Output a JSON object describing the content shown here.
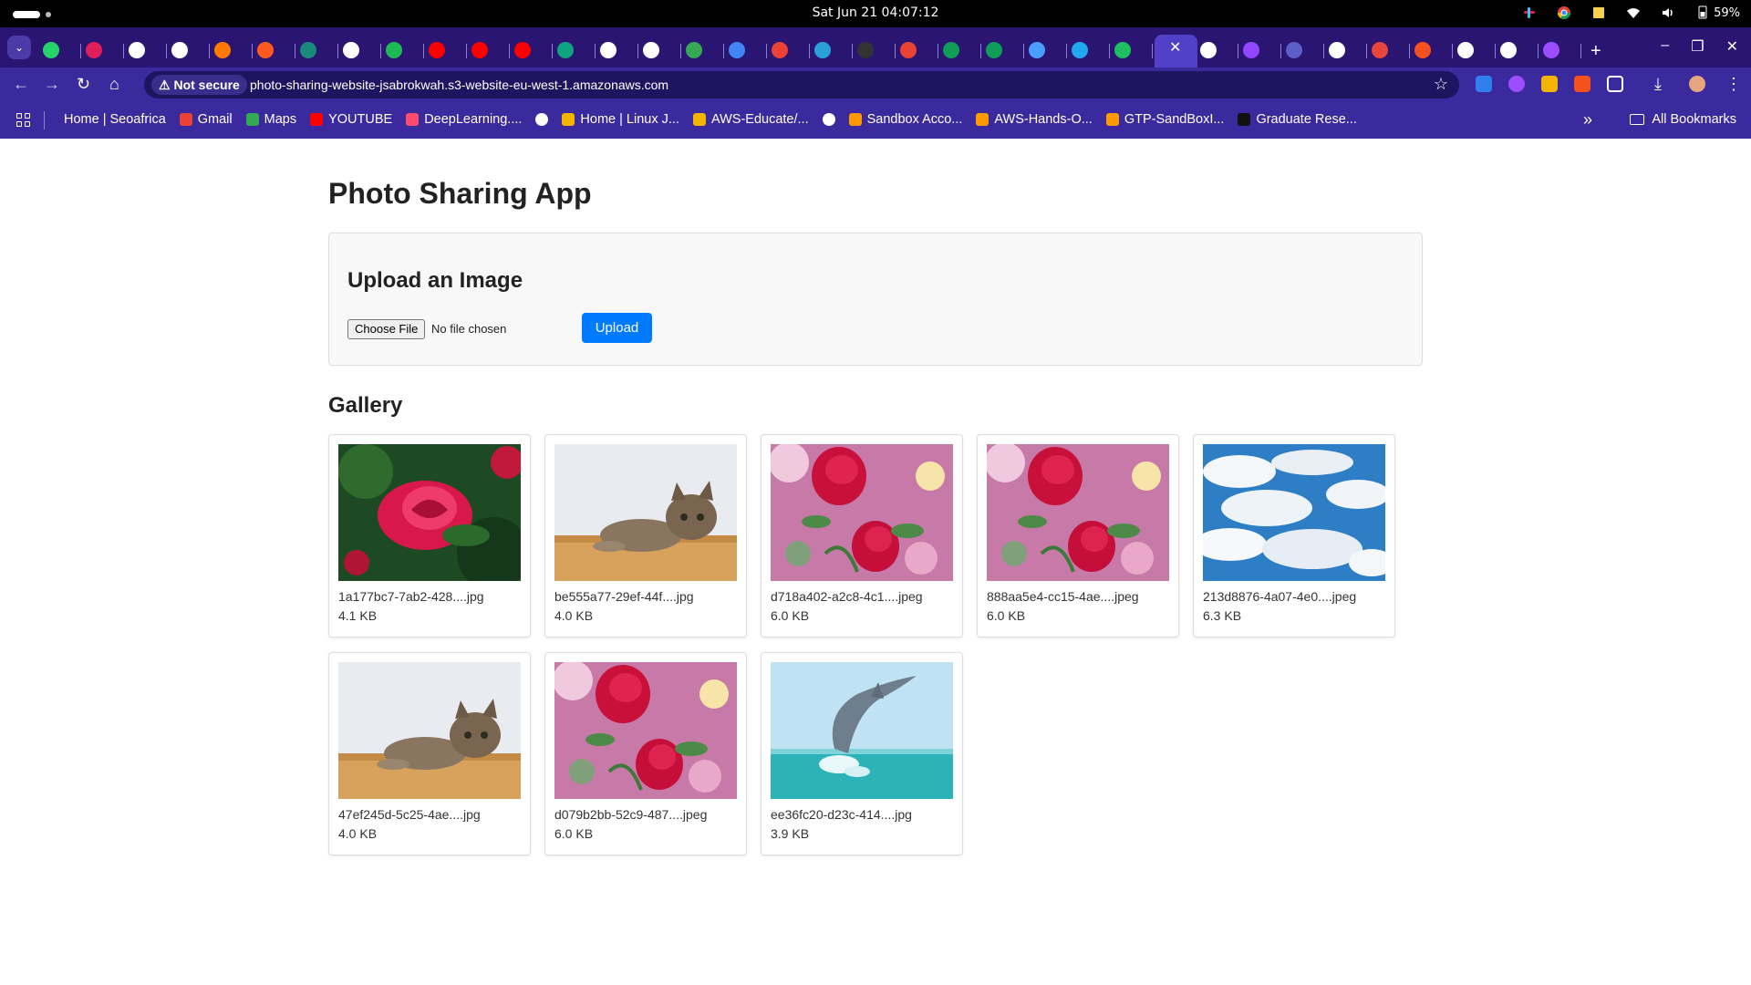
{
  "system": {
    "clock": "Sat Jun 21  04:07:12",
    "battery": "59%"
  },
  "browser": {
    "active_tab_close": "✕",
    "new_tab": "+",
    "tab_favicon_colors": [
      "#25d366",
      "#e01e5a",
      "#ffffff",
      "#ffffff",
      "#ff7a00",
      "#ff5a1f",
      "#1a8a7a",
      "#ffffff",
      "#1db954",
      "#ff0000",
      "#ff0000",
      "#ff0000",
      "#10a37f",
      "#ffffff",
      "#ffffff",
      "#34a853",
      "#4285f4",
      "#ea4335",
      "#2aa0d8",
      "#333333",
      "#ea4335",
      "#0f9d58",
      "#0f9d58",
      "#4a9eff",
      "#22a7f0",
      "#1fbf5f",
      "#ffffff",
      "#9146ff",
      "#5b5fc7",
      "#ffffff",
      "#e8453c",
      "#f4511e",
      "#ffffff",
      "#ffffff",
      "#9c4dff"
    ],
    "url": "photo-sharing-website-jsabrokwah.s3-website-eu-west-1.amazonaws.com",
    "security_label": "Not secure",
    "bookmarks": [
      {
        "label": "Home | Seoafrica",
        "color": "#3b2a9e"
      },
      {
        "label": "Gmail",
        "color": "#ea4335"
      },
      {
        "label": "Maps",
        "color": "#34a853"
      },
      {
        "label": "YOUTUBE",
        "color": "#ff0000"
      },
      {
        "label": "DeepLearning....",
        "color": "#ff4b6e"
      },
      {
        "label": "",
        "color": "#ffffff"
      },
      {
        "label": "Home | Linux J...",
        "color": "#f4b400"
      },
      {
        "label": "AWS-Educate/...",
        "color": "#f4b400"
      },
      {
        "label": "",
        "color": "#ffffff"
      },
      {
        "label": "Sandbox Acco...",
        "color": "#ff9900"
      },
      {
        "label": "AWS-Hands-O...",
        "color": "#ff9900"
      },
      {
        "label": "GTP-SandBoxI...",
        "color": "#ff9900"
      },
      {
        "label": "Graduate Rese...",
        "color": "#111111"
      }
    ],
    "bookmarks_more": "»",
    "all_bookmarks": "All Bookmarks"
  },
  "app": {
    "title": "Photo Sharing App",
    "upload": {
      "heading": "Upload an Image",
      "choose_file_label": "Choose File",
      "file_status": "No file chosen",
      "upload_button": "Upload"
    },
    "gallery_title": "Gallery",
    "accent_color": "#007bff",
    "images": [
      {
        "name": "1a177bc7-7ab2-428....jpg",
        "size": "4.1 KB",
        "subject": "red-rose-garden"
      },
      {
        "name": "be555a77-29ef-44f....jpg",
        "size": "4.0 KB",
        "subject": "tabby-cat"
      },
      {
        "name": "d718a402-a2c8-4c1....jpeg",
        "size": "6.0 KB",
        "subject": "red-roses-bokeh"
      },
      {
        "name": "888aa5e4-cc15-4ae....jpeg",
        "size": "6.0 KB",
        "subject": "red-roses-bokeh"
      },
      {
        "name": "213d8876-4a07-4e0....jpeg",
        "size": "6.3 KB",
        "subject": "cloudy-sky"
      },
      {
        "name": "47ef245d-5c25-4ae....jpg",
        "size": "4.0 KB",
        "subject": "tabby-cat"
      },
      {
        "name": "d079b2bb-52c9-487....jpeg",
        "size": "6.0 KB",
        "subject": "red-roses-bokeh"
      },
      {
        "name": "ee36fc20-d23c-414....jpg",
        "size": "3.9 KB",
        "subject": "jumping-dolphin"
      }
    ]
  }
}
